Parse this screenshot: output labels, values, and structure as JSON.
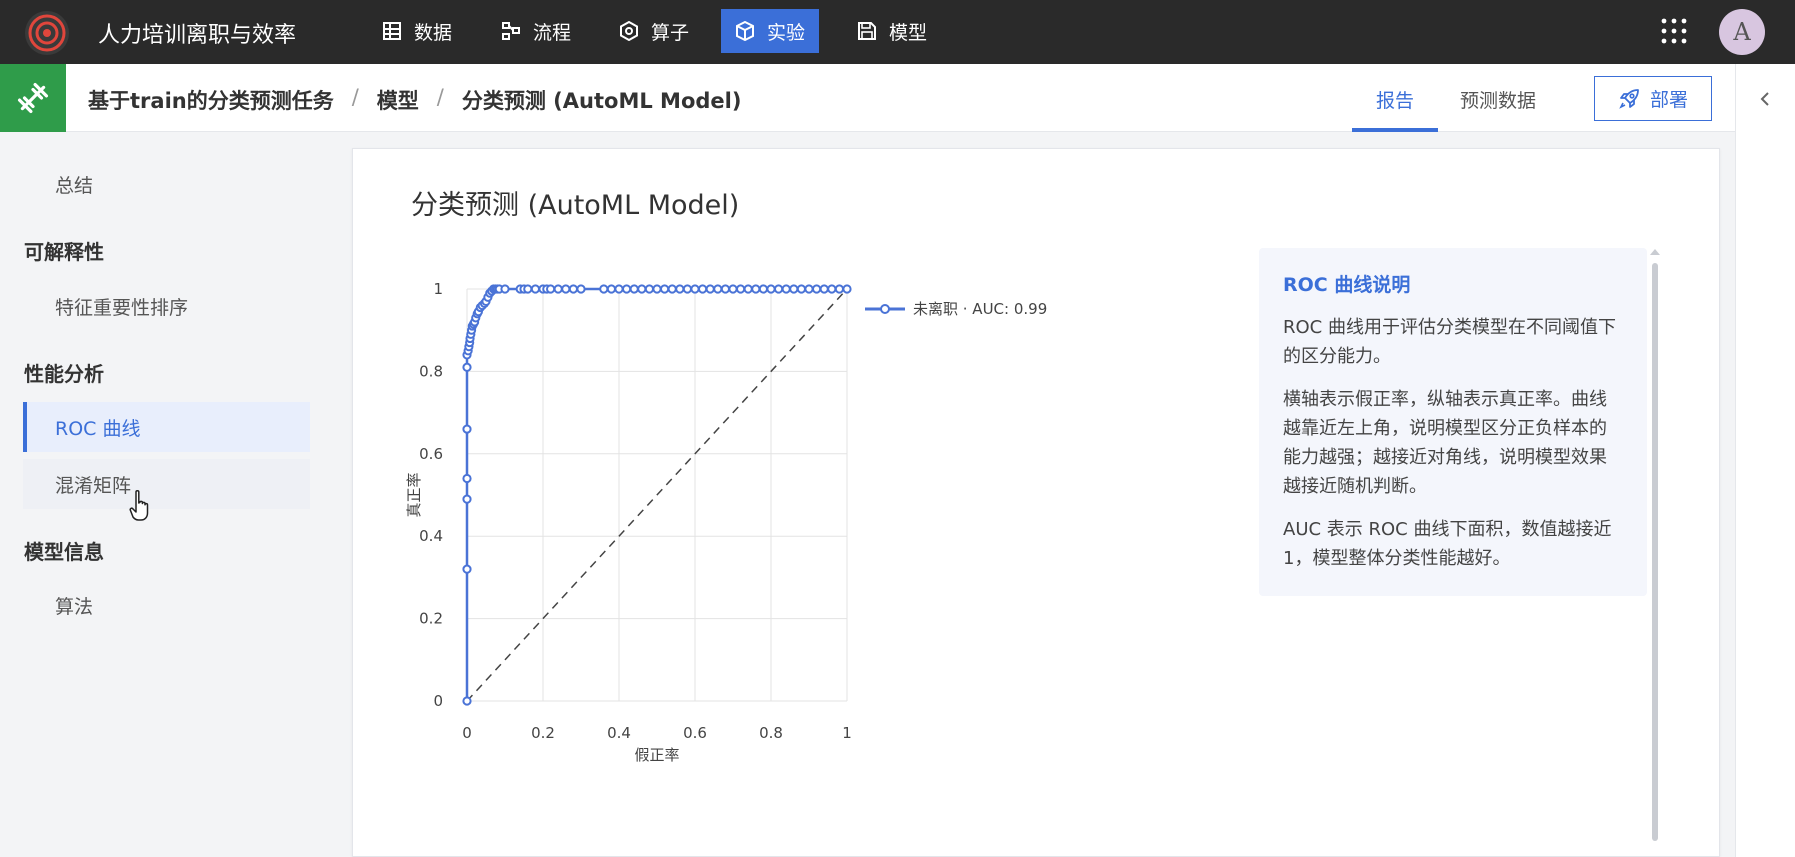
{
  "app": {
    "title": "人力培训离职与效率"
  },
  "nav": [
    {
      "label": "数据",
      "icon": "table-icon"
    },
    {
      "label": "流程",
      "icon": "flow-icon"
    },
    {
      "label": "算子",
      "icon": "operator-icon"
    },
    {
      "label": "实验",
      "icon": "cube-icon",
      "active": true
    },
    {
      "label": "模型",
      "icon": "save-icon"
    }
  ],
  "user": {
    "avatar_letter": "A"
  },
  "breadcrumb": [
    "基于train的分类预测任务",
    "模型",
    "分类预测 (AutoML Model)"
  ],
  "breadcrumb_sep": "/",
  "tabs": {
    "report": "报告",
    "predict": "预测数据"
  },
  "deploy_label": "部署",
  "sidebar": {
    "summary": "总结",
    "groups": [
      {
        "label": "可解释性",
        "items": [
          "特征重要性排序"
        ]
      },
      {
        "label": "性能分析",
        "items": [
          "ROC 曲线",
          "混淆矩阵"
        ]
      },
      {
        "label": "模型信息",
        "items": [
          "算法"
        ]
      }
    ],
    "active_item": "ROC 曲线"
  },
  "card": {
    "title": "分类预测 (AutoML Model)"
  },
  "chart_data": {
    "type": "line",
    "xlabel": "假正率",
    "ylabel": "真正率",
    "xlim": [
      0,
      1
    ],
    "ylim": [
      0,
      1
    ],
    "xticks": [
      "0",
      "0.2",
      "0.4",
      "0.6",
      "0.8",
      "1"
    ],
    "yticks": [
      "0",
      "0.2",
      "0.4",
      "0.6",
      "0.8",
      "1"
    ],
    "grid": true,
    "legend_position": "top-right",
    "series": [
      {
        "name": "未离职 · AUC: 0.99",
        "color": "#4a73d6",
        "x": [
          0,
          0,
          0,
          0,
          0,
          0,
          0,
          0.003,
          0.005,
          0.007,
          0.008,
          0.01,
          0.012,
          0.014,
          0.017,
          0.02,
          0.023,
          0.027,
          0.03,
          0.035,
          0.04,
          0.046,
          0.05,
          0.055,
          0.06,
          0.065,
          0.07,
          0.075,
          0.08,
          0.085,
          0.1,
          0.14,
          0.15,
          0.16,
          0.18,
          0.2,
          0.21,
          0.22,
          0.24,
          0.26,
          0.28,
          0.3,
          0.36,
          0.38,
          0.4,
          0.42,
          0.44,
          0.46,
          0.48,
          0.5,
          0.52,
          0.54,
          0.56,
          0.58,
          0.6,
          0.62,
          0.64,
          0.66,
          0.68,
          0.7,
          0.72,
          0.74,
          0.76,
          0.78,
          0.8,
          0.82,
          0.84,
          0.86,
          0.88,
          0.9,
          0.92,
          0.94,
          0.96,
          0.98,
          1
        ],
        "y": [
          0,
          0.32,
          0.49,
          0.54,
          0.66,
          0.81,
          0.84,
          0.85,
          0.86,
          0.87,
          0.88,
          0.89,
          0.9,
          0.91,
          0.915,
          0.92,
          0.93,
          0.94,
          0.945,
          0.955,
          0.96,
          0.965,
          0.97,
          0.98,
          0.99,
          0.995,
          1,
          1,
          1,
          1,
          1,
          1,
          1,
          1,
          1,
          1,
          1,
          1,
          1,
          1,
          1,
          1,
          1,
          1,
          1,
          1,
          1,
          1,
          1,
          1,
          1,
          1,
          1,
          1,
          1,
          1,
          1,
          1,
          1,
          1,
          1,
          1,
          1,
          1,
          1,
          1,
          1,
          1,
          1,
          1,
          1,
          1,
          1,
          1,
          1
        ]
      }
    ],
    "diagonal": true
  },
  "info": {
    "title": "ROC 曲线说明",
    "paragraphs": [
      "ROC 曲线用于评估分类模型在不同阈值下的区分能力。",
      "横轴表示假正率，纵轴表示真正率。曲线越靠近左上角，说明模型区分正负样本的能力越强；越接近对角线，说明模型效果越接近随机判断。",
      "AUC 表示 ROC 曲线下面积，数值越接近 1，模型整体分类性能越好。"
    ]
  }
}
